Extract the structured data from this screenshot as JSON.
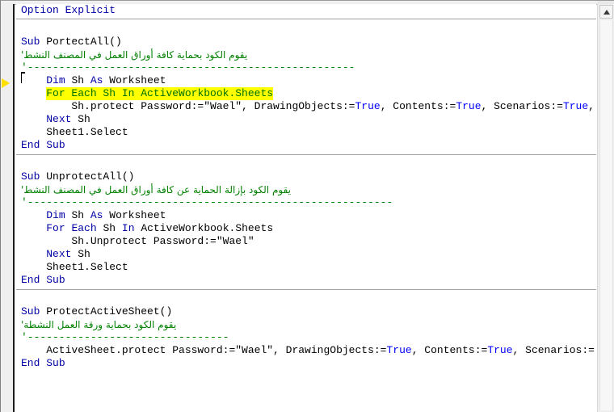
{
  "window": {
    "title": "VBA Code Editor",
    "editor_background": "#ffffff",
    "margin_background": "#efefef"
  },
  "colors": {
    "keyword": "#0000a5",
    "comment": "#008000",
    "literal": "#0000ff",
    "identifier": "#000000",
    "highlight_background": "#ffff00",
    "highlight_text": "#007000",
    "margin_arrow": "#ffe000"
  },
  "scrollbar": {
    "up_arrow_icon": "triangle-up-icon",
    "orientation": "vertical"
  },
  "margin": {
    "current_statement_marker_icon": "yellow-arrow-icon"
  },
  "code": {
    "header": {
      "option_explicit": "Option Explicit"
    },
    "procedures": [
      {
        "name": "PortectAll",
        "signature": "Sub PortectAll()",
        "comment_arabic": "يقوم الكود بحماية كافة أوراق العمل في المصنف النشط'",
        "comment_rule": "'----------------------------------------------------",
        "lines": [
          "    Dim Sh As Worksheet",
          "    For Each Sh In ActiveWorkbook.Sheets",
          "        Sh.protect Password:=\"Wael\", DrawingObjects:=True, Contents:=True, Scenarios:=True,",
          "    Next Sh",
          "    Sheet1.Select",
          "End Sub"
        ],
        "highlighted_line": "For Each Sh In ActiveWorkbook.Sheets"
      },
      {
        "name": "UnprotectAll",
        "signature": "Sub UnprotectAll()",
        "comment_arabic": "يقوم الكود بإزالة الحماية عن كافة أوراق العمل في المصنف النشط'",
        "comment_rule": "'----------------------------------------------------------",
        "lines": [
          "    Dim Sh As Worksheet",
          "    For Each Sh In ActiveWorkbook.Sheets",
          "        Sh.Unprotect Password:=\"Wael\"",
          "    Next Sh",
          "    Sheet1.Select",
          "End Sub"
        ]
      },
      {
        "name": "ProtectActiveSheet",
        "signature": "Sub ProtectActiveSheet()",
        "comment_arabic": "يقوم الكود بحماية ورقة العمل النشطة'",
        "comment_rule": "'--------------------------------",
        "lines": [
          "    ActiveSheet.protect Password:=\"Wael\", DrawingObjects:=True, Contents:=True, Scenarios:=",
          "End Sub"
        ]
      }
    ],
    "tokens": {
      "sub": "Sub",
      "end_sub_end": "End",
      "end_sub_sub": "Sub",
      "dim": "Dim",
      "as": "As",
      "for": "For",
      "each": "Each",
      "in": "In",
      "next": "Next",
      "option": "Option",
      "explicit": "Explicit",
      "true": "True",
      "sh": "Sh",
      "worksheet": "Worksheet",
      "activeworkbook_sheets": "ActiveWorkbook.Sheets",
      "sheet1_select": "Sheet1.Select",
      "proc1_name": "PortectAll()",
      "proc2_name": "UnprotectAll()",
      "proc3_name": "ProtectActiveSheet()",
      "sh_protect_head": "        Sh.protect Password:=\"Wael\", DrawingObjects:=",
      "sh_protect_mid1": ", Contents:=",
      "sh_protect_mid2": ", Scenarios:=",
      "sh_protect_tail": ",",
      "sh_unprotect": "        Sh.Unprotect Password:=\"Wael\"",
      "active_protect_head": "    ActiveSheet.protect Password:=\"Wael\", DrawingObjects:=",
      "active_protect_mid1": ", Contents:=",
      "active_protect_tail": ", Scenarios:=",
      "next_sh_tail": " Sh",
      "for_each_hl": "For Each Sh In ActiveWorkbook.Sheets"
    }
  }
}
